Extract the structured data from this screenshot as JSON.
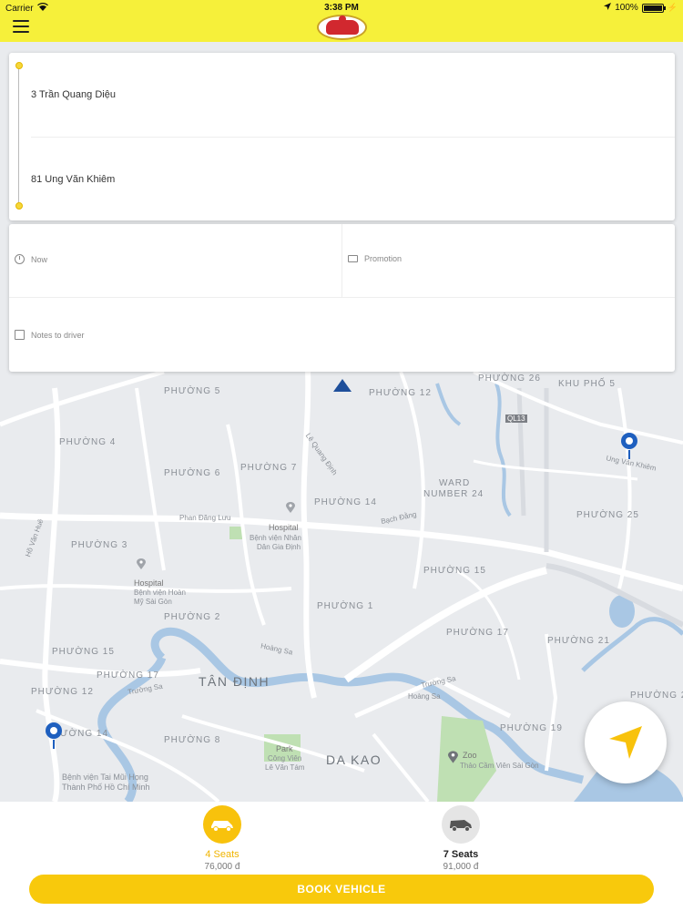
{
  "status_bar": {
    "carrier": "Carrier",
    "time": "3:38 PM",
    "battery": "100%"
  },
  "route": {
    "pickup": "3 Trần Quang Diệu",
    "dropoff": "81 Ung Văn Khiêm"
  },
  "options": {
    "time": "Now",
    "promotion": "Promotion",
    "notes_placeholder": "Notes to driver"
  },
  "map": {
    "labels": {
      "phuong5": "PHƯỜNG 5",
      "phuong12": "PHƯỜNG 12",
      "phuong26": "PHƯỜNG 26",
      "khupho5": "KHU PHỐ 5",
      "phuong4": "PHƯỜNG 4",
      "phuong6": "PHƯỜNG 6",
      "phuong7": "PHƯỜNG 7",
      "ward24a": "WARD",
      "ward24b": "NUMBER 24",
      "phuong14": "PHƯỜNG 14",
      "phuong25": "PHƯỜNG 25",
      "phuong3": "PHƯỜNG 3",
      "phuong15a": "PHƯỜNG 15",
      "phuong1": "PHƯỜNG 1",
      "phuong2": "PHƯỜNG 2",
      "phuong17a": "PHƯỜNG 17",
      "phuong21": "PHƯỜNG 21",
      "phuong15b": "PHƯỜNG 15",
      "phuong17b": "PHƯỜNG 17",
      "tandinh": "TÂN ĐỊNH",
      "phuong12b": "PHƯỜNG 12",
      "phuong2b": "PHƯỜNG 2",
      "phuong14b": "ƯỜNG 14",
      "phuong19": "PHƯỜNG 19",
      "phuong8": "PHƯỜNG 8",
      "dakao": "DA KAO",
      "hospital1": "Hospital",
      "hospital1b": "Bệnh viện Nhân",
      "hospital1c": "Dân Gia Định",
      "hospital2": "Hospital",
      "hospital2b": "Bệnh viện Hoàn",
      "hospital2c": "Mỹ Sài Gòn",
      "park": "Park",
      "parkb": "Công Viên",
      "parkc": "Lê Văn Tám",
      "zoo": "Zoo",
      "zoob": "Thảo Cầm Viên Sài Gòn",
      "benhvien": "Bệnh viện Tai Mũi Họng",
      "benhvienb": "Thành Phố Hồ Chí Minh",
      "ungvankhiem": "Ung Văn Khiêm",
      "phandangluu": "Phan Đăng Lưu",
      "bachdang": "Bạch Đằng",
      "lequangdinh": "Lê Quang Định",
      "hoangsa": "Hoàng Sa",
      "truongsa": "Trường Sa",
      "ql13": "QL13",
      "huynhvanbanh": "Hồ Văn Huê"
    }
  },
  "vehicles": [
    {
      "name": "4 Seats",
      "price": "76,000 đ"
    },
    {
      "name": "7 Seats",
      "price": "91,000 đ"
    }
  ],
  "book_button": "BOOK VEHICLE",
  "colors": {
    "header": "#f6f03a",
    "accent": "#f8c90c",
    "pin": "#1e5fbf",
    "water": "#a9c7e4",
    "park": "#bfe0b3"
  }
}
